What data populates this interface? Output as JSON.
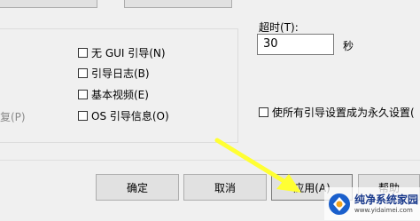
{
  "boot_options": {
    "checkboxes": [
      {
        "label": "无 GUI 引导(N)",
        "checked": false
      },
      {
        "label": "引导日志(B)",
        "checked": false
      },
      {
        "label": "基本视频(E)",
        "checked": false
      },
      {
        "label": "OS 引导信息(O)",
        "checked": false
      }
    ],
    "cut_off_label": "复(P)"
  },
  "timeout": {
    "label": "超时(T):",
    "value": "30",
    "unit": "秒"
  },
  "permanent_checkbox": {
    "label": "使所有引导设置成为永久设置(",
    "checked": false
  },
  "buttons": {
    "ok": "确定",
    "cancel": "取消",
    "apply": "应用(A)",
    "help": "帮助"
  },
  "watermark": {
    "title": "纯净系统家园",
    "url": "www.yidaimei.com"
  },
  "annotation": {
    "arrow_color": "#ffff33"
  }
}
